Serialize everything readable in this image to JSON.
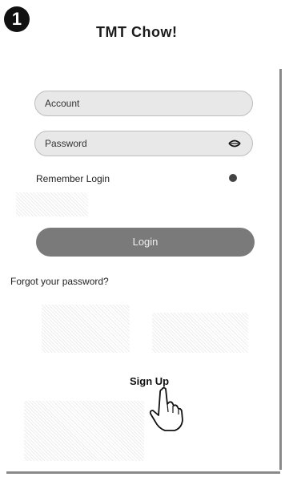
{
  "step": {
    "number": "1"
  },
  "header": {
    "title": "TMT Chow!"
  },
  "form": {
    "account_placeholder": "Account",
    "password_placeholder": "Password",
    "remember_label": "Remember Login",
    "login_label": "Login",
    "forgot_label": "Forgot your password?"
  },
  "footer": {
    "signup_label": "Sign Up"
  },
  "icons": {
    "password_toggle": "eye-icon",
    "tap_gesture": "pointing-hand-icon"
  },
  "colors": {
    "login_button": "#7a7a7a",
    "field_background": "#e8e8e8",
    "badge": "#111111"
  }
}
